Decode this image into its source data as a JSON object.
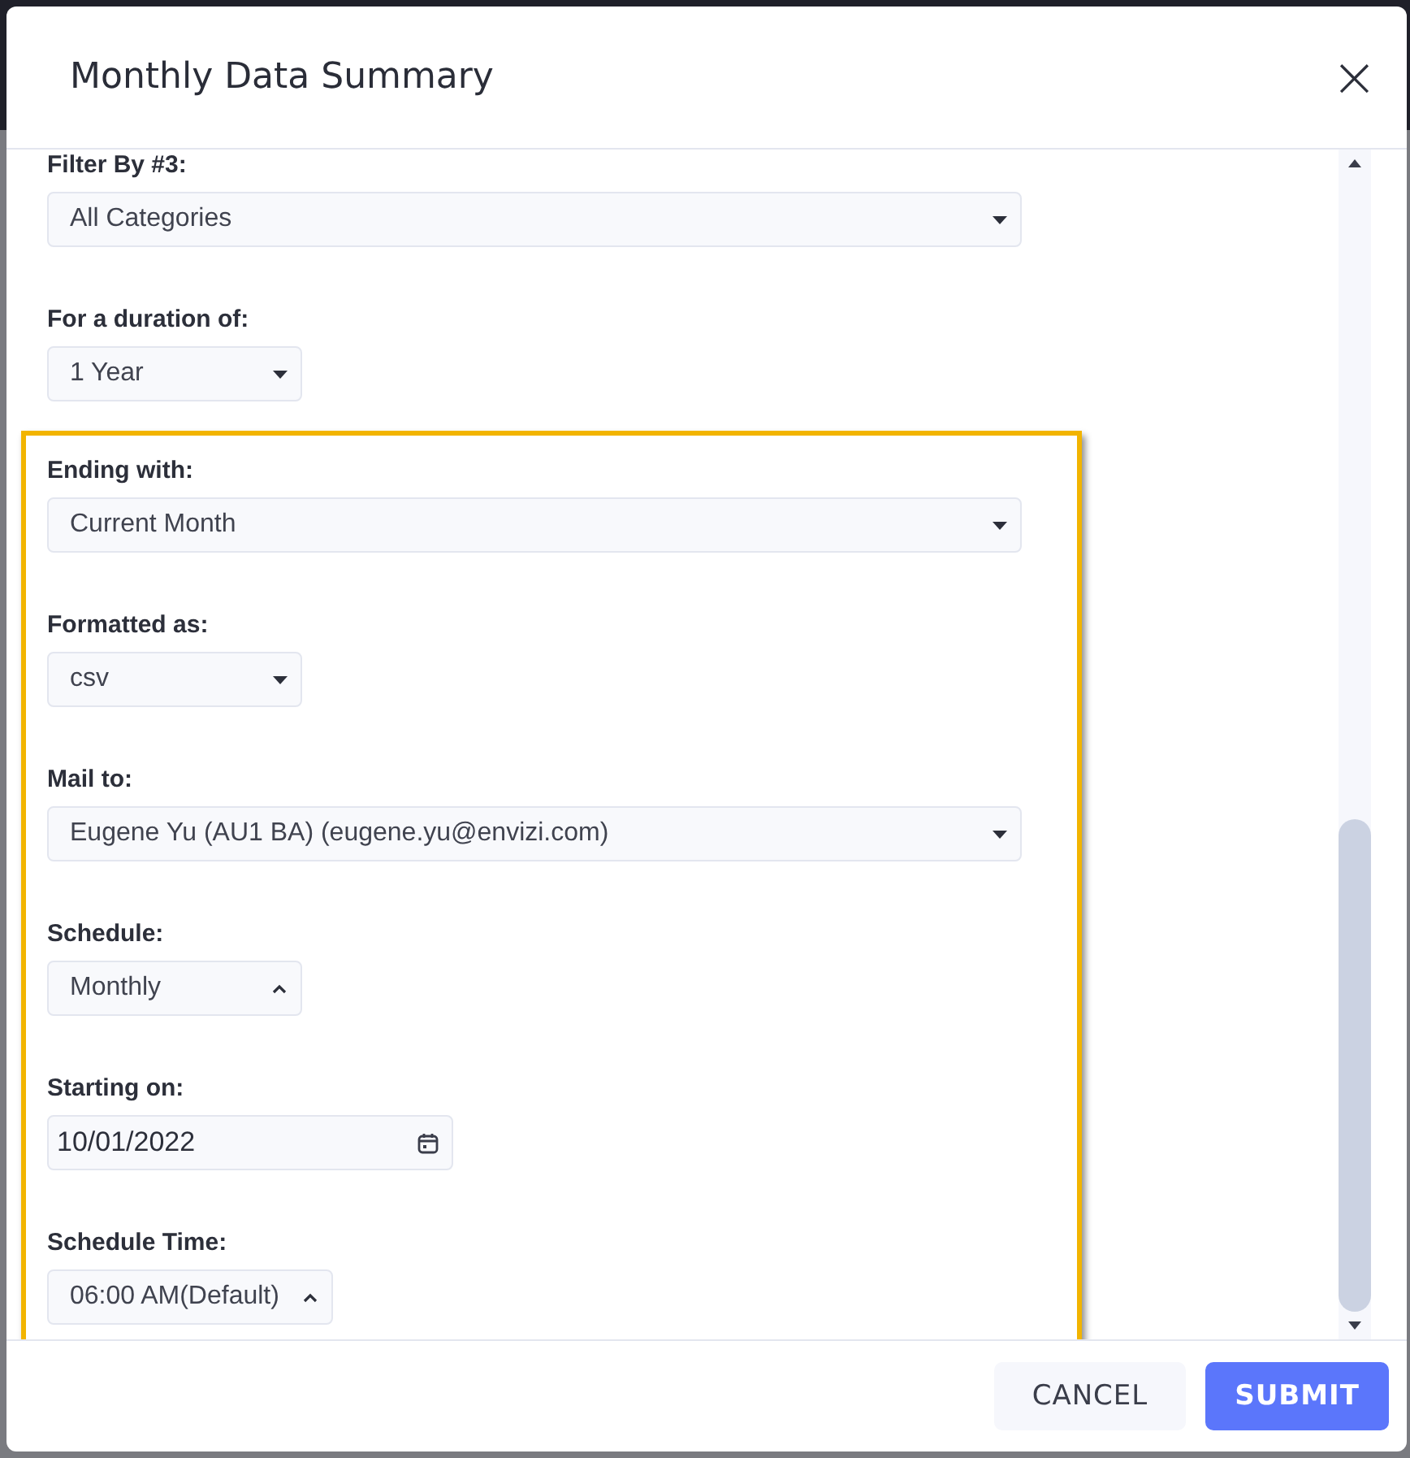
{
  "dialog": {
    "title": "Monthly Data Summary",
    "close": "×"
  },
  "fields": [
    {
      "kind": "wide-select",
      "label": "Filter By #3:",
      "value": "All Categories",
      "expanded": false
    },
    {
      "kind": "select",
      "label": "For a duration of:",
      "value": "1 Year",
      "expanded": false
    }
  ],
  "highlighted_fields": [
    {
      "kind": "wide-select",
      "label": "Ending with:",
      "value": "Current Month",
      "expanded": false
    },
    {
      "kind": "select",
      "label": "Formatted as:",
      "value": "csv",
      "expanded": false
    },
    {
      "kind": "wide-select",
      "label": "Mail to:",
      "value": "Eugene Yu (AU1 BA) (eugene.yu@envizi.com)",
      "expanded": false
    },
    {
      "kind": "select",
      "label": "Schedule:",
      "value": "Monthly",
      "expanded": true
    },
    {
      "kind": "date",
      "label": "Starting on:",
      "value": "10/01/2022"
    },
    {
      "kind": "select",
      "label": "Schedule Time:",
      "value": "06:00 AM(Default)",
      "expanded": true
    }
  ],
  "buttons": [
    {
      "kind": "secondary",
      "label": "CANCEL"
    },
    {
      "kind": "primary",
      "label": "SUBMIT"
    }
  ]
}
